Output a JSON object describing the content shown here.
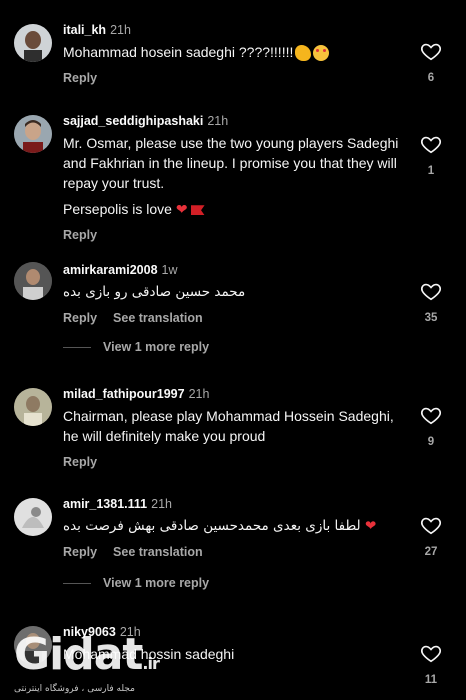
{
  "ui": {
    "reply_label": "Reply",
    "see_translation_label": "See translation",
    "view_more_replies_label": "View 1 more reply"
  },
  "comments": [
    {
      "username": "itali_kh",
      "time": "21h",
      "text": "Mohammad hosein sadeghi ????!!!!!!",
      "likes": "6",
      "emoji": [
        "flexed-biceps-icon",
        "heart-eyes-face-icon"
      ]
    },
    {
      "username": "sajjad_seddighipashaki",
      "time": "21h",
      "text": "Mr. Osmar, please use the two young players Sadeghi and Fakhrian in the lineup. I promise you that they will repay your trust.",
      "text2": "Persepolis is love",
      "likes": "1",
      "emoji": [
        "red-heart-icon",
        "red-flag-icon"
      ]
    },
    {
      "username": "amirkarami2008",
      "time": "1w",
      "text": "محمد حسین صادقی رو بازی بده",
      "likes": "35"
    },
    {
      "username": "milad_fathipour1997",
      "time": "21h",
      "text": "Chairman, please play Mohammad Hossein Sadeghi, he will definitely make you proud",
      "likes": "9"
    },
    {
      "username": "amir_1381.111",
      "time": "21h",
      "text": "لطفا بازی بعدی محمدحسین صادقی بهش فرصت بده",
      "likes": "27",
      "emoji": [
        "red-heart-icon"
      ]
    },
    {
      "username": "niky9063",
      "time": "21h",
      "text": "Mohammad hossin sadeghi",
      "likes": "11"
    }
  ],
  "watermark": {
    "logo": "Gidat",
    "suffix": ".ir",
    "tagline": "مجله فارسی ، فروشگاه اینترنتی"
  },
  "colors": {
    "background": "#000000",
    "text": "#f5f5f5",
    "muted": "#a8a8a8",
    "heart": "#e8313a"
  }
}
